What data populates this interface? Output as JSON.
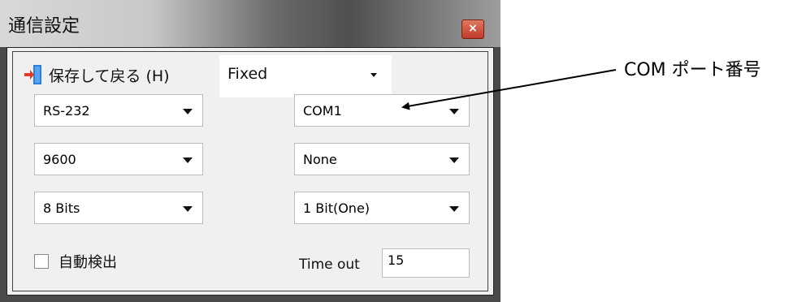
{
  "window": {
    "title": "通信設定",
    "close_label": "×"
  },
  "toolbar": {
    "save_label": "保存して戻る (H)",
    "mode_value": "Fixed"
  },
  "left_dropdowns": [
    "RS-232",
    "9600",
    "8 Bits"
  ],
  "right_dropdowns": [
    "COM1",
    "None",
    "1 Bit(One)"
  ],
  "auto_detect": {
    "label": "自動検出",
    "checked": false
  },
  "timeout": {
    "label": "Time out",
    "value": "15"
  },
  "annotation": {
    "text": "COM ポート番号"
  },
  "colors": {
    "save_icon_blue": "#2a7de1",
    "save_icon_red": "#e23b2a",
    "close_button": "#c0392b"
  }
}
